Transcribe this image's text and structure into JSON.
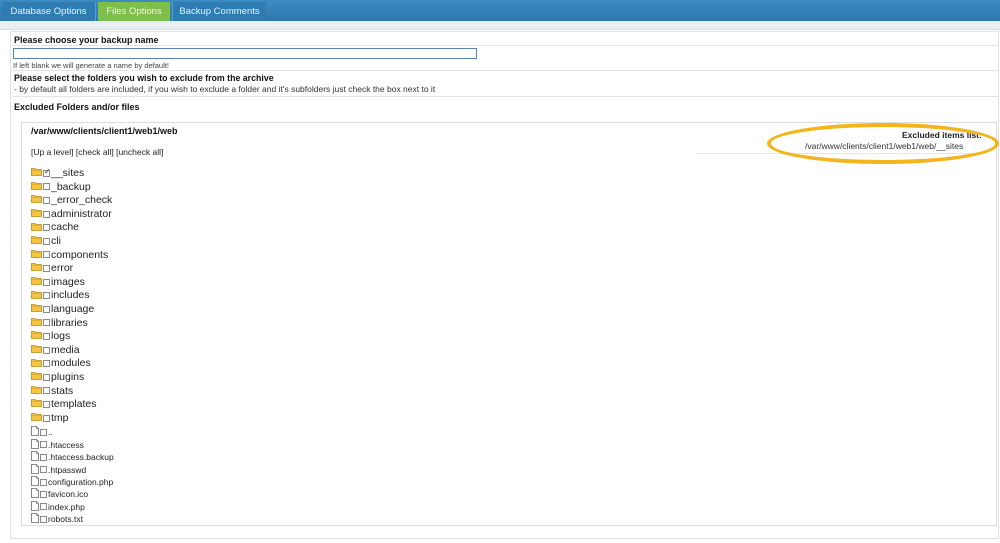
{
  "tabs": [
    {
      "label": "Database Options"
    },
    {
      "label": "Files Options"
    },
    {
      "label": "Backup Comments"
    }
  ],
  "colors": {
    "active_tab": "#7fbe4a",
    "tab_bar": "#2a78ae",
    "highlight_oval": "#f2b51c"
  },
  "backup_name": {
    "heading": "Please choose your backup name",
    "value": "",
    "hint": "If left blank we will generate a name by default!"
  },
  "exclude": {
    "heading": "Please select the folders you wish to exclude from the archive",
    "note": "- by default all folders are included, if you wish to exclude a folder and it's subfolders just check the box next to it",
    "section_title": "Excluded Folders and/or files"
  },
  "browser": {
    "current_path": "/var/www/clients/client1/web1/web",
    "up_level": "[Up a level]",
    "check_all": "[check all]",
    "uncheck_all": "[uncheck all]",
    "excluded_title": "Excluded items list:",
    "excluded_items": [
      "/var/www/clients/client1/web1/web/__sites"
    ]
  },
  "folders": [
    {
      "name": "__sites",
      "checked": true
    },
    {
      "name": "_backup",
      "checked": false
    },
    {
      "name": "_error_check",
      "checked": false
    },
    {
      "name": "administrator",
      "checked": false
    },
    {
      "name": "cache",
      "checked": false
    },
    {
      "name": "cli",
      "checked": false
    },
    {
      "name": "components",
      "checked": false
    },
    {
      "name": "error",
      "checked": false
    },
    {
      "name": "images",
      "checked": false
    },
    {
      "name": "includes",
      "checked": false
    },
    {
      "name": "language",
      "checked": false
    },
    {
      "name": "libraries",
      "checked": false
    },
    {
      "name": "logs",
      "checked": false
    },
    {
      "name": "media",
      "checked": false
    },
    {
      "name": "modules",
      "checked": false
    },
    {
      "name": "plugins",
      "checked": false
    },
    {
      "name": "stats",
      "checked": false
    },
    {
      "name": "templates",
      "checked": false
    },
    {
      "name": "tmp",
      "checked": false
    }
  ],
  "files": [
    {
      "name": "..",
      "checked": false
    },
    {
      "name": ".htaccess",
      "checked": false
    },
    {
      "name": ".htaccess.backup",
      "checked": false
    },
    {
      "name": ".htpasswd",
      "checked": false
    },
    {
      "name": "configuration.php",
      "checked": false
    },
    {
      "name": "favicon.ico",
      "checked": false
    },
    {
      "name": "index.php",
      "checked": false
    },
    {
      "name": "robots.txt",
      "checked": false
    }
  ]
}
